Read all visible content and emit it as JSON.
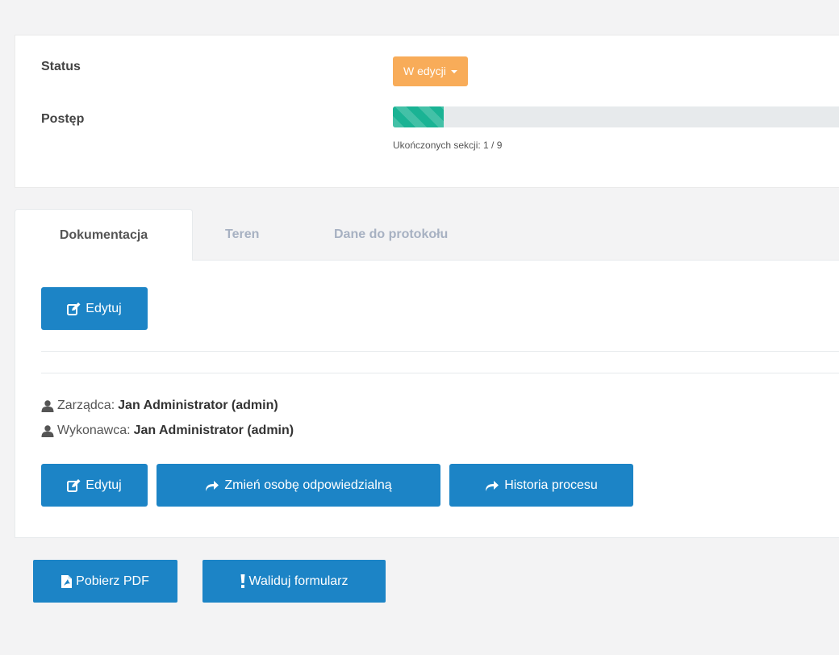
{
  "info": {
    "status_label": "Status",
    "status_value": "W edycji",
    "progress_label": "Postęp",
    "progress_text": "Ukończonych sekcji: 1 / 9",
    "progress_completed": 1,
    "progress_total": 9,
    "status_color": "#f8ac59",
    "progress_color": "#1ab394"
  },
  "tabs": [
    {
      "label": "Dokumentacja",
      "active": true
    },
    {
      "label": "Teren",
      "active": false
    },
    {
      "label": "Dane do protokołu",
      "active": false
    }
  ],
  "content": {
    "edit_label": "Edytuj",
    "manager_label": "Zarządca:",
    "manager_value": "Jan Administrator (admin)",
    "executor_label": "Wykonawca:",
    "executor_value": "Jan Administrator (admin)",
    "edit_label_2": "Edytuj",
    "change_person_label": "Zmień osobę odpowiedzialną",
    "history_label": "Historia procesu"
  },
  "actions": {
    "pdf_label": "Pobierz PDF",
    "validate_label": "Waliduj formularz"
  },
  "colors": {
    "primary": "#1c84c6",
    "background": "#f3f3f4"
  },
  "icons": {
    "edit": "edit-icon",
    "share": "share-icon",
    "user": "user-icon",
    "pdf": "file-pdf-icon",
    "exclamation": "exclamation-icon"
  }
}
